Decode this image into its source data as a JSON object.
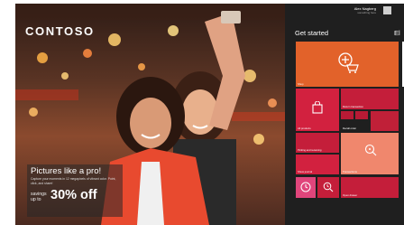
{
  "brand": {
    "logo": "CONTOSO"
  },
  "promo": {
    "headline": "Pictures like a pro!",
    "subtext": "Capture your moments in 12 megapixels of vibrant color. Point, click, and share!",
    "savings_label": "savings up to",
    "discount": "30% off"
  },
  "user": {
    "name": "Alex Nagberg",
    "subtitle": "something here"
  },
  "start": {
    "title": "Get started",
    "next_title": "El",
    "tiles": {
      "shop": "Shop",
      "all_products": "All products",
      "return": "Return transaction",
      "recall": "Recall order",
      "picking": "Picking and receiving",
      "journal": "Show journal",
      "tag": "Transactions",
      "open_drawer": "Open drawer"
    }
  },
  "colors": {
    "orange": "#e2622a",
    "crimson": "#c41e3a",
    "red": "#d2213f",
    "salmon": "#f0876d",
    "pink": "#e0457b"
  }
}
